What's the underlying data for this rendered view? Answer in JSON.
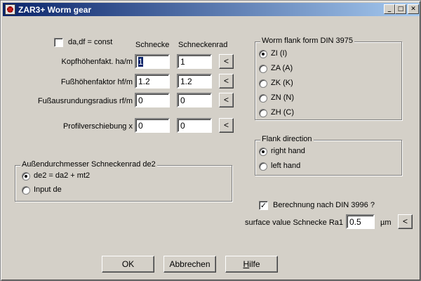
{
  "window": {
    "title": "ZAR3+  Worm gear",
    "controls": {
      "minimize": "_",
      "maximize": "□",
      "close": "✕"
    }
  },
  "left": {
    "const_checkbox": {
      "label": "da,df = const",
      "checked": false
    },
    "column_headers": {
      "worm": "Schnecke",
      "wheel": "Schneckenrad"
    },
    "rows": [
      {
        "label": "Kopfhöhenfakt. ha/m",
        "worm_value": "1",
        "wheel_value": "1",
        "copy_button": "<"
      },
      {
        "label": "Fußhöhenfaktor hf/m",
        "worm_value": "1.2",
        "wheel_value": "1.2",
        "copy_button": "<"
      },
      {
        "label": "Fußausrundungsradius rf/m",
        "worm_value": "0",
        "wheel_value": "0",
        "copy_button": "<"
      },
      {
        "label": "Profilverschiebung x",
        "worm_value": "0",
        "wheel_value": "0",
        "copy_button": "<"
      }
    ],
    "outer_diameter": {
      "title": "Außendurchmesser Schneckenrad de2",
      "options": [
        {
          "label": "de2 = da2 + mt2",
          "selected": true
        },
        {
          "label": "Input de",
          "selected": false
        }
      ]
    }
  },
  "right": {
    "flank_form": {
      "title": "Worm flank form  DIN 3975",
      "options": [
        {
          "label": "ZI (I)",
          "selected": true
        },
        {
          "label": "ZA (A)",
          "selected": false
        },
        {
          "label": "ZK (K)",
          "selected": false
        },
        {
          "label": "ZN (N)",
          "selected": false
        },
        {
          "label": "ZH (C)",
          "selected": false
        }
      ]
    },
    "flank_direction": {
      "title": "Flank direction",
      "options": [
        {
          "label": "right hand",
          "selected": true
        },
        {
          "label": "left hand",
          "selected": false
        }
      ]
    },
    "din3996": {
      "label": "Berechnung nach DIN 3996 ?",
      "checked": true
    },
    "surface": {
      "label": "surface value Schnecke Ra1",
      "value": "0.5",
      "unit": "µm",
      "copy_button": "<"
    }
  },
  "buttons": {
    "ok": "OK",
    "cancel": "Abbrechen",
    "help_first": "H",
    "help_rest": "ilfe"
  },
  "marks": {
    "check": "✓"
  }
}
